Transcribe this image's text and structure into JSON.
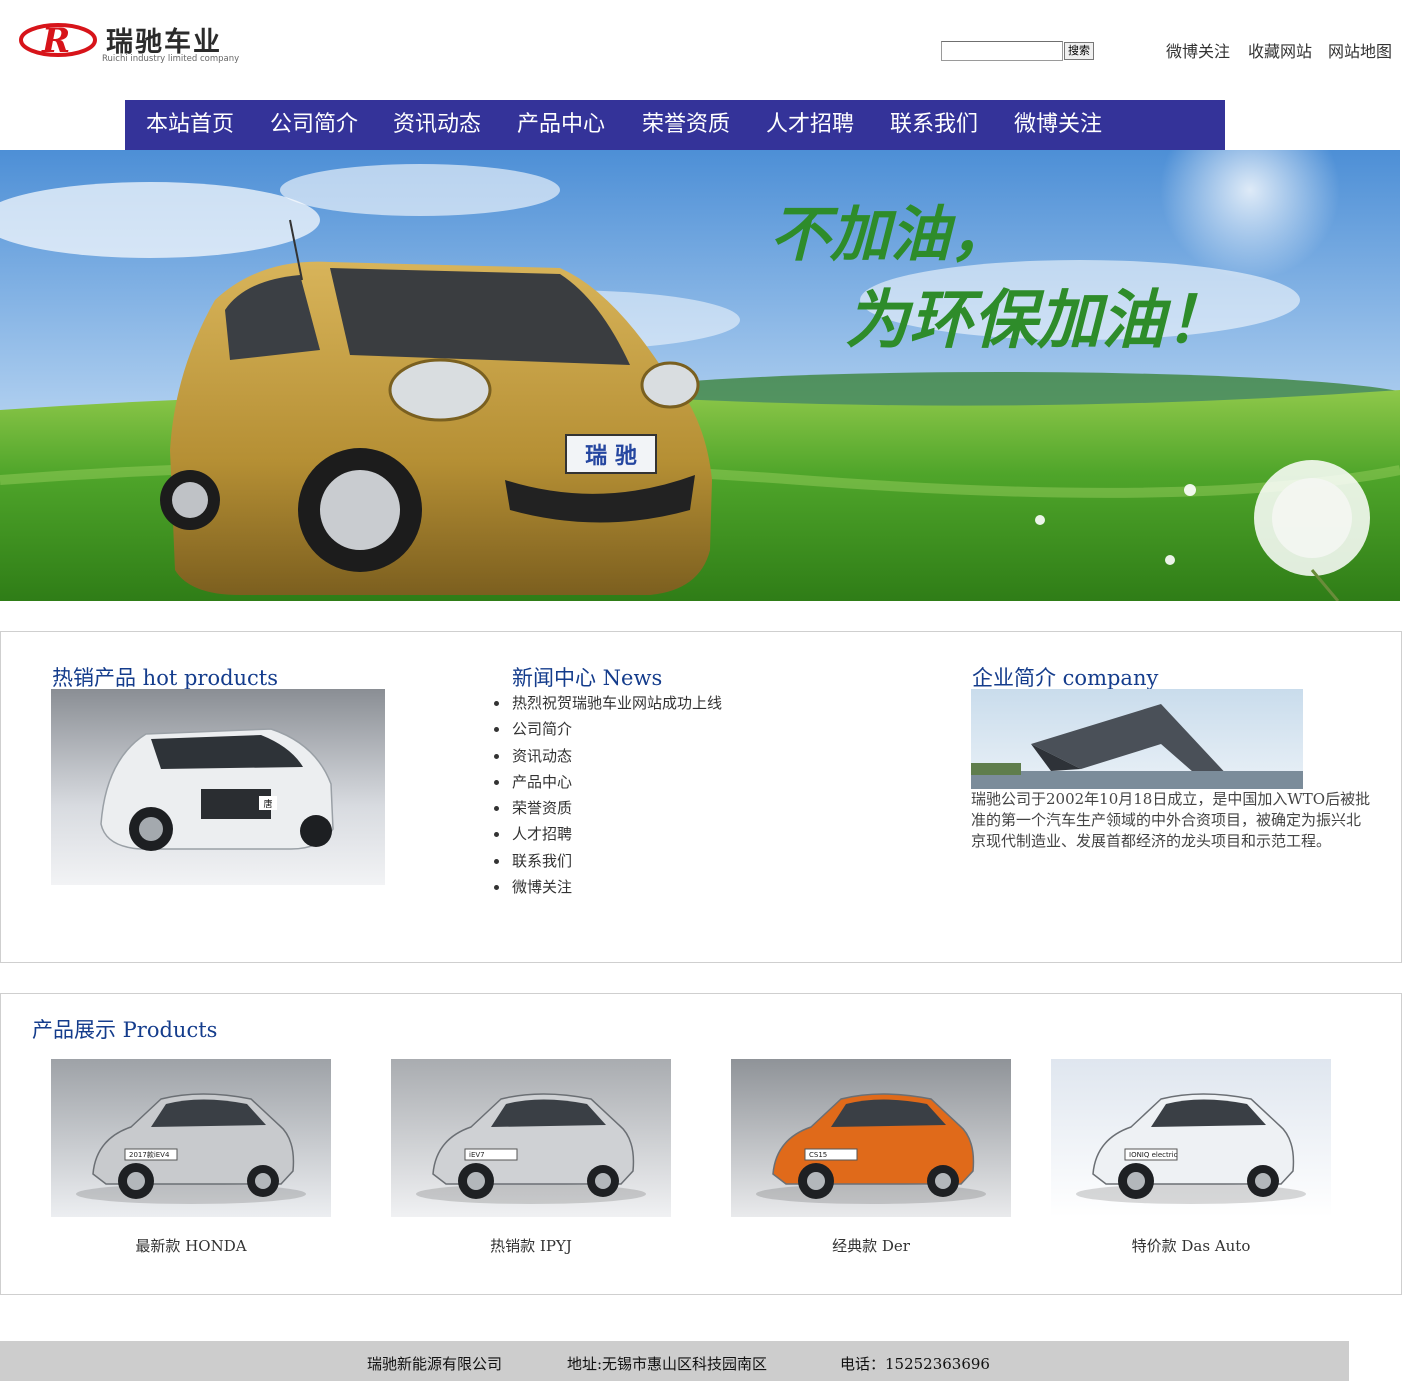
{
  "header": {
    "logo_name": "瑞驰车业",
    "logo_sub": "Ruichi industry limited company",
    "search_button": "搜索",
    "search_value": "",
    "top_links": [
      "微博关注",
      "收藏网站",
      "网站地图"
    ]
  },
  "nav": {
    "items": [
      "本站首页",
      "公司简介",
      "资讯动态",
      "产品中心",
      "荣誉资质",
      "人才招聘",
      "联系我们",
      "微博关注"
    ]
  },
  "banner": {
    "line1": "不加油，",
    "line2": "为环保加油！",
    "plate": "瑞  驰"
  },
  "hot_products": {
    "title": "热销产品 hot products",
    "plate": "唐"
  },
  "news": {
    "title": "新闻中心 News",
    "items": [
      "热烈祝贺瑞驰车业网站成功上线",
      "公司简介",
      "资讯动态",
      "产品中心",
      "荣誉资质",
      "人才招聘",
      "联系我们",
      "微博关注"
    ]
  },
  "company": {
    "title": "企业简介 company",
    "text": "瑞驰公司于2002年10月18日成立，是中国加入WTO后被批准的第一个汽车生产领域的中外合资项目，被确定为振兴北京现代制造业、发展首都经济的龙头项目和示范工程。"
  },
  "products": {
    "title": "产品展示 Products",
    "items": [
      {
        "caption": "最新款 HONDA",
        "plate": "2017款iEV4",
        "color": "#c8cacd"
      },
      {
        "caption": "热销款 IPYJ",
        "plate": "iEV7",
        "color": "#cfd1d4"
      },
      {
        "caption": "经典款 Der",
        "plate": "CS15",
        "color": "#e06a1a"
      },
      {
        "caption": "特价款 Das Auto",
        "plate": "IONIQ electric",
        "color": "#eef1f4"
      }
    ]
  },
  "footer": {
    "company": "瑞驰新能源有限公司",
    "address": "地址:无锡市惠山区科技园南区",
    "phone": "电话：15252363696"
  },
  "colors": {
    "nav_bg": "#343399",
    "title_blue": "#143c8c",
    "footer_bg": "#cdcdcd"
  }
}
